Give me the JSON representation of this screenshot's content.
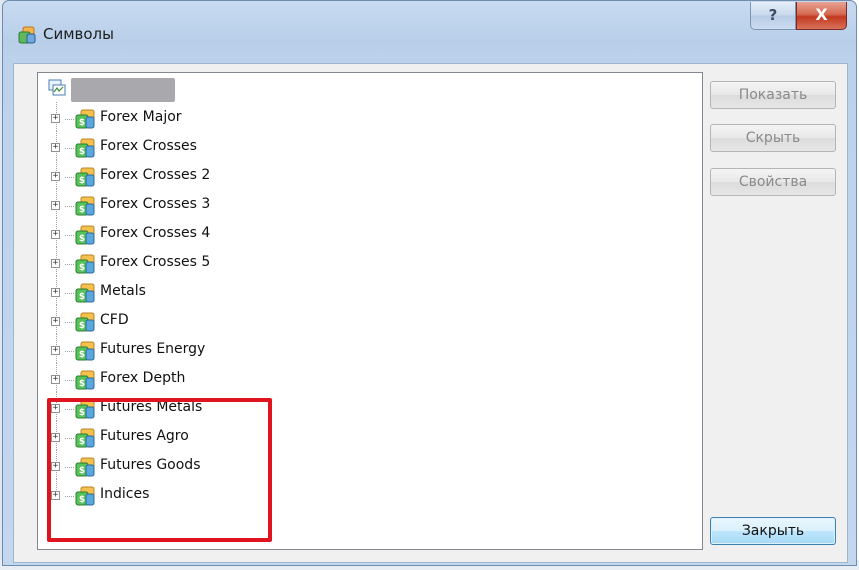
{
  "window": {
    "title": "Символы",
    "help_label": "?",
    "close_label": "X"
  },
  "tree": {
    "root_label": "",
    "items": [
      {
        "label": "Forex Major"
      },
      {
        "label": "Forex Crosses"
      },
      {
        "label": "Forex Crosses 2"
      },
      {
        "label": "Forex Crosses 3"
      },
      {
        "label": "Forex Crosses 4"
      },
      {
        "label": "Forex Crosses 5"
      },
      {
        "label": "Metals"
      },
      {
        "label": "CFD"
      },
      {
        "label": "Futures Energy"
      },
      {
        "label": "Forex Depth"
      },
      {
        "label": "Futures Metals"
      },
      {
        "label": "Futures Agro"
      },
      {
        "label": "Futures Goods"
      },
      {
        "label": "Indices"
      }
    ],
    "expander_glyph": "+",
    "icon": "symbol-folder-icon"
  },
  "buttons": {
    "show": "Показать",
    "hide": "Скрыть",
    "properties": "Свойства",
    "close": "Закрыть"
  },
  "colors": {
    "highlight": "#e0141e",
    "titlebar": "#bcd2ec",
    "close_button": "#c2391f"
  }
}
